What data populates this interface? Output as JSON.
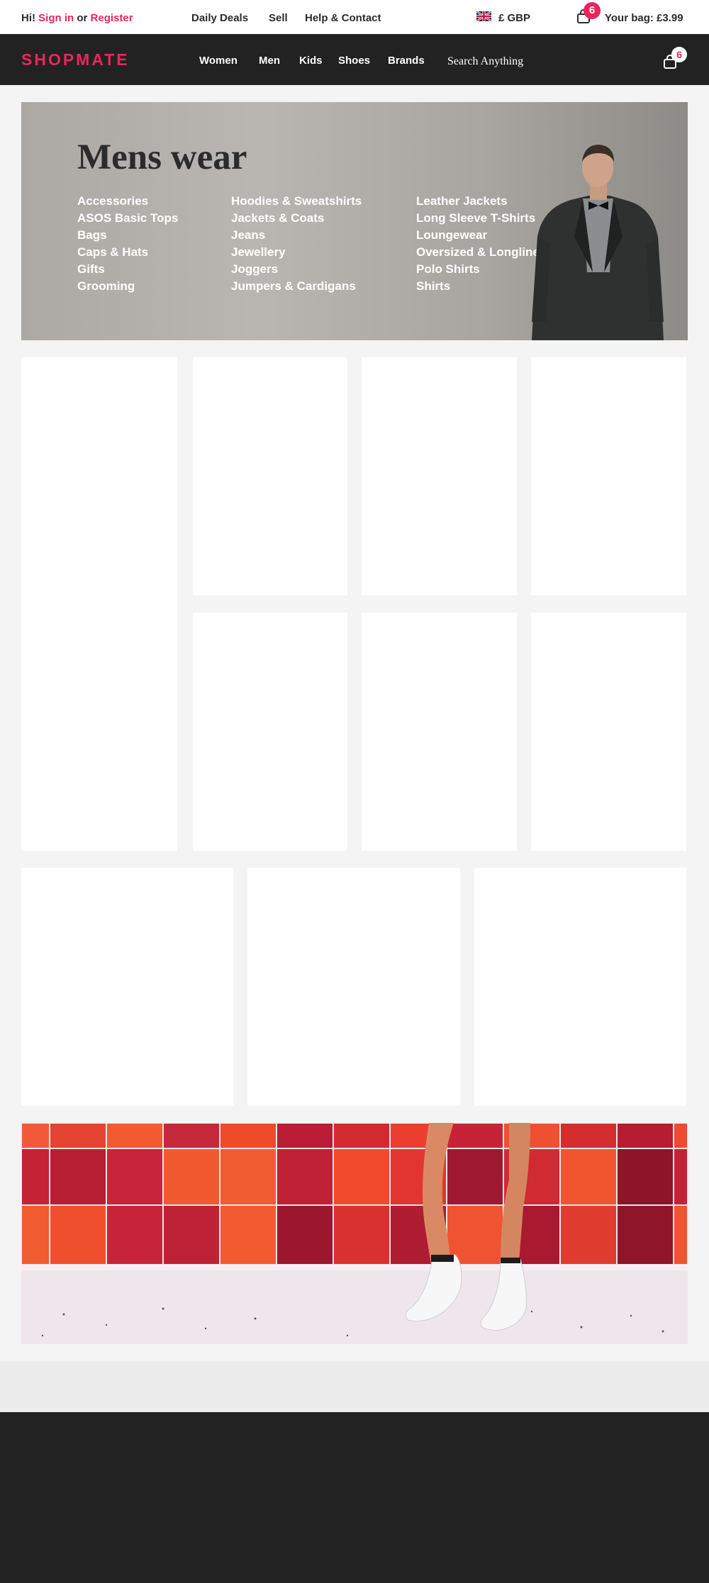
{
  "topbar": {
    "greeting": "Hi!",
    "sign_in": "Sign in",
    "or": "or",
    "register": "Register",
    "links": [
      "Daily Deals",
      "Sell",
      "Help & Contact"
    ],
    "currency": "£ GBP",
    "flag_icon": "uk-flag-icon",
    "bag_count": "6",
    "bag_total": "Your bag: £3.99"
  },
  "navbar": {
    "logo": "SHOPMATE",
    "items": [
      "Women",
      "Men",
      "Kids",
      "Shoes",
      "Brands"
    ],
    "search_placeholder": "Search Anything",
    "bag_count": "6",
    "bag_icon": "shopping-bag-icon"
  },
  "hero": {
    "title": "Mens wear",
    "columns": [
      [
        "Accessories",
        "ASOS Basic Tops",
        "Bags",
        "Caps & Hats",
        "Gifts",
        "Grooming"
      ],
      [
        "Hoodies & Sweatshirts",
        "Jackets & Coats",
        "Jeans",
        "Jewellery",
        "Joggers",
        "Jumpers & Cardigans"
      ],
      [
        "Leather Jackets",
        "Long Sleeve T-Shirts",
        "Loungewear",
        "Oversized & Longline",
        "Polo Shirts",
        "Shirts"
      ]
    ]
  },
  "colors": {
    "accent": "#e8265e",
    "dark": "#222222",
    "page_bg": "#f4f4f4"
  }
}
